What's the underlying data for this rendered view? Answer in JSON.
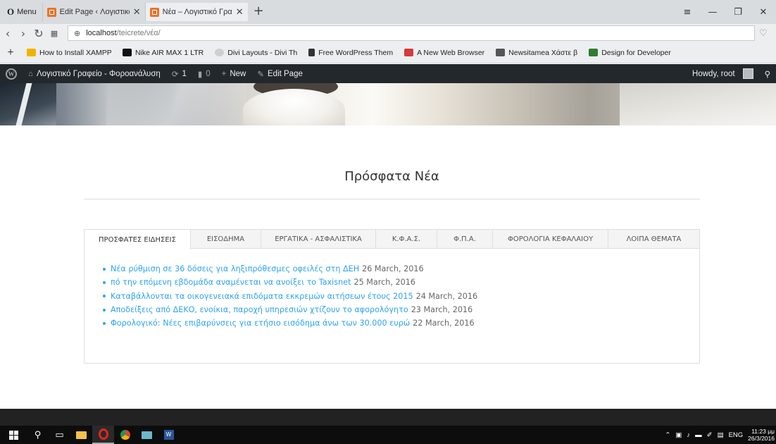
{
  "browser": {
    "menu_label": "Menu",
    "tabs": [
      {
        "title": "Edit Page ‹ Λογιστικό Γραφ",
        "active": false
      },
      {
        "title": "Νέα – Λογιστικό Γραφείο",
        "active": true
      }
    ],
    "new_tab": "+",
    "url_host": "localhost",
    "url_path": "/teicrete/νέα/",
    "bookmarks": [
      {
        "label": "How to Install XAMPP",
        "color": "#f0b400"
      },
      {
        "label": "Nike AIR MAX 1 LTR",
        "color": "#111111"
      },
      {
        "label": "Divi Layouts - Divi Th",
        "color": "#cfcfcf"
      },
      {
        "label": "Free WordPress Them",
        "color": "#333333"
      },
      {
        "label": "A New Web Browser",
        "color": "#d63a3a"
      },
      {
        "label": "Newsitamea Χάστε β",
        "color": "#555555"
      },
      {
        "label": "Design for Developer",
        "color": "#2e7d32"
      }
    ]
  },
  "admin_bar": {
    "site_name": "Λογιστικό Γραφείο - Φοροανάλυση",
    "updates_count": "1",
    "comments_count": "0",
    "new_label": "New",
    "edit_label": "Edit Page",
    "howdy": "Howdy, root"
  },
  "page": {
    "title": "Πρόσφατα Νέα",
    "tabs": [
      {
        "label": "ΠΡΟΣΦΑΤΕΣ ΕΙΔΗΣΕΙΣ",
        "active": true
      },
      {
        "label": "ΕΙΣΟΔΗΜΑ",
        "active": false
      },
      {
        "label": "ΕΡΓΑΤΙΚΑ - ΑΣΦΑΛΙΣΤΙΚΑ",
        "active": false
      },
      {
        "label": "Κ.Φ.Α.Σ.",
        "active": false
      },
      {
        "label": "Φ.Π.Α.",
        "active": false
      },
      {
        "label": "ΦΟΡΟΛΟΓΙΑ ΚΕΦΑΛΑΙΟΥ",
        "active": false
      },
      {
        "label": "ΛΟΙΠΑ ΘΕΜΑΤΑ",
        "active": false
      }
    ],
    "news": [
      {
        "link": "Νέα ρύθμιση σε 36 δόσεις για ληξιπρόθεσμες οφειλές στη ΔΕΗ",
        "date": "26 March, 2016"
      },
      {
        "link": "πό την επόμενη εβδομάδα αναμένεται να ανοίξει το Taxisnet",
        "date": "25 March, 2016"
      },
      {
        "link": "Καταβάλλονται τα οικογενειακά επιδόματα εκκρεμών αιτήσεων έτους 2015",
        "date": "24 March, 2016"
      },
      {
        "link": "Αποδείξεις από ΔΕΚΟ, ενοίκια, παροχή υπηρεσιών χτίζουν το αφορολόγητο",
        "date": "23 March, 2016"
      },
      {
        "link": "Φορολογικό: Νέες επιβαρύνσεις για ετήσιο εισόδημα άνω των 30.000 ευρώ",
        "date": "22 March, 2016"
      }
    ]
  },
  "taskbar": {
    "language": "ENG",
    "time": "11:23 μμ",
    "date": "26/3/2016"
  },
  "colors": {
    "link": "#2ea3f2",
    "admin_bar": "#23282d",
    "footer": "#222222"
  }
}
